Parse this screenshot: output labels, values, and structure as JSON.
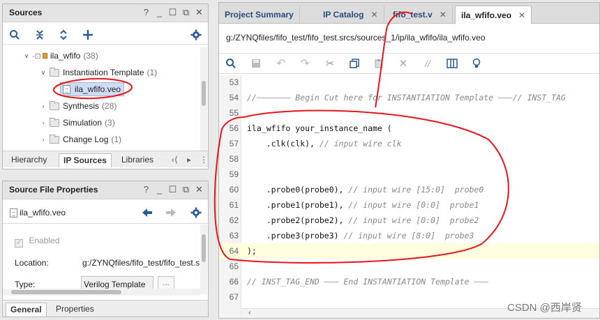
{
  "sources": {
    "title": "Sources",
    "tree": [
      {
        "label": "ila_wfifo",
        "count": "(38)"
      },
      {
        "label": "Instantiation Template",
        "count": "(1)"
      },
      {
        "label": "ila_wfifo.veo",
        "count": ""
      },
      {
        "label": "Synthesis",
        "count": "(28)"
      },
      {
        "label": "Simulation",
        "count": "(3)"
      },
      {
        "label": "Change Log",
        "count": "(1)"
      }
    ],
    "tabs": [
      "Hierarchy",
      "IP Sources",
      "Libraries"
    ]
  },
  "props": {
    "title": "Source File Properties",
    "file": "ila_wfifo.veo",
    "enabled": "Enabled",
    "location_label": "Location:",
    "location_value": "g:/ZYNQfiles/fifo_test/fifo_test.s",
    "type_label": "Type:",
    "type_value": "Verilog Template",
    "more": "...",
    "tabs": [
      "General",
      "Properties"
    ]
  },
  "editor": {
    "tabs": [
      "Project Summary",
      "IP Catalog",
      "fifo_test.v",
      "ila_wfifo.veo"
    ],
    "path": "g:/ZYNQfiles/fifo_test/fifo_test.srcs/sources_1/ip/ila_wfifo/ila_wfifo.veo",
    "lines": [
      {
        "n": "53",
        "code": "",
        "comment": ""
      },
      {
        "n": "54",
        "code": "",
        "comment": "//——————— Begin Cut here for INSTANTIATION Template ———// INST_TAG"
      },
      {
        "n": "55",
        "code": "",
        "comment": ""
      },
      {
        "n": "56",
        "code": "ila_wfifo your_instance_name (",
        "comment": ""
      },
      {
        "n": "57",
        "code": "    .clk(clk), ",
        "comment": "// input wire clk"
      },
      {
        "n": "58",
        "code": "",
        "comment": ""
      },
      {
        "n": "59",
        "code": "",
        "comment": ""
      },
      {
        "n": "60",
        "code": "    .probe0(probe0), ",
        "comment": "// input wire [15:0]  probe0"
      },
      {
        "n": "61",
        "code": "    .probe1(probe1), ",
        "comment": "// input wire [0:0]  probe1"
      },
      {
        "n": "62",
        "code": "    .probe2(probe2), ",
        "comment": "// input wire [0:0]  probe2"
      },
      {
        "n": "63",
        "code": "    .probe3(probe3) ",
        "comment": "// input wire [8:0]  probe3"
      },
      {
        "n": "64",
        "code": ");",
        "comment": ""
      },
      {
        "n": "65",
        "code": "",
        "comment": ""
      },
      {
        "n": "66",
        "code": "",
        "comment": "// INST_TAG_END ——— End INSTANTIATION Template ———"
      },
      {
        "n": "67",
        "code": "",
        "comment": ""
      }
    ]
  },
  "watermark": "CSDN @西岸贤",
  "colors": {
    "annotation": "#e8161a",
    "selection": "#cfdcf5",
    "highlight_line": "#ffffe0"
  }
}
